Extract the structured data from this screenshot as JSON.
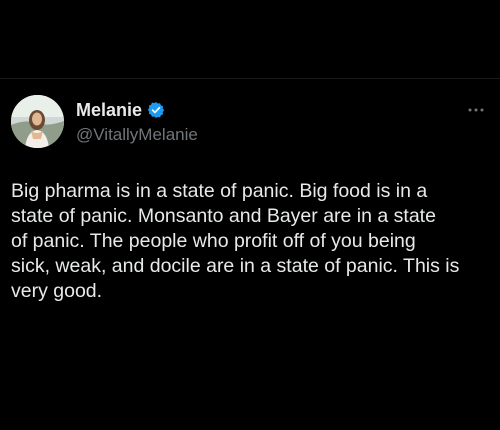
{
  "author": {
    "display_name": "Melanie",
    "handle": "@VitallyMelanie",
    "verified": true,
    "avatar_icon": "profile-photo"
  },
  "tweet": {
    "text": "Big pharma is in a state of panic. Big food is in a\nstate of panic. Monsanto and Bayer are in a state\nof panic. The people who profit off of you being\nsick, weak, and docile are in a state of panic. This is\nvery good."
  },
  "colors": {
    "background": "#000000",
    "text": "#e7e9ea",
    "secondary_text": "#71767b",
    "verified_badge": "#1d9bf0"
  },
  "icons": {
    "verified": "verified-badge-icon",
    "more": "more-options-icon"
  }
}
